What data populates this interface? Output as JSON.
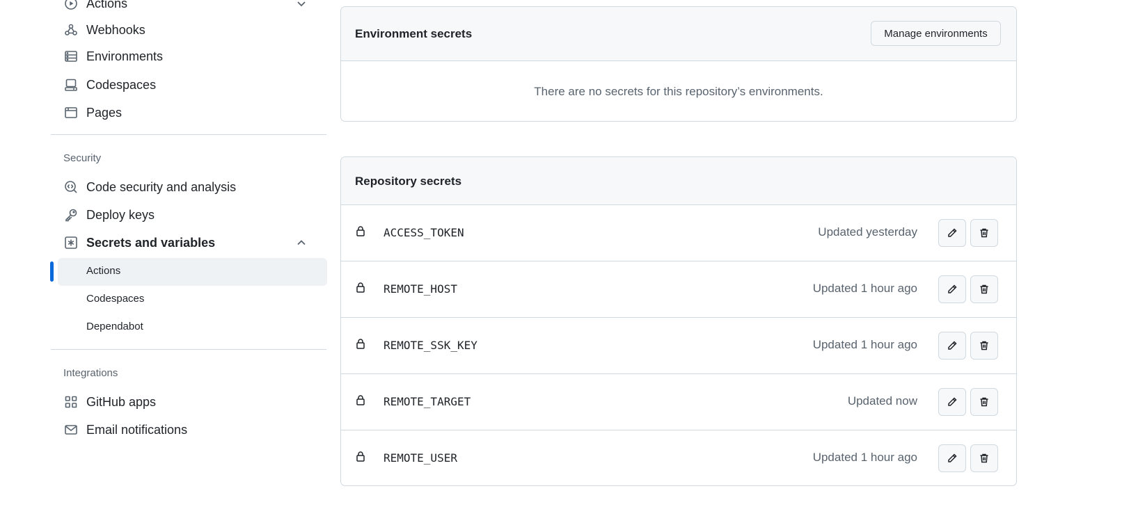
{
  "sidebar": {
    "top_items": [
      {
        "label": "Actions",
        "icon": "play-icon"
      },
      {
        "label": "Webhooks",
        "icon": "webhook-icon"
      },
      {
        "label": "Environments",
        "icon": "server-icon"
      },
      {
        "label": "Codespaces",
        "icon": "codespaces-icon"
      },
      {
        "label": "Pages",
        "icon": "browser-icon"
      }
    ],
    "security_heading": "Security",
    "security_items": [
      {
        "label": "Code security and analysis",
        "icon": "codescan-icon"
      },
      {
        "label": "Deploy keys",
        "icon": "key-icon"
      },
      {
        "label": "Secrets and variables",
        "icon": "key-asterisk-icon"
      }
    ],
    "secrets_subitems": [
      {
        "label": "Actions",
        "active": true
      },
      {
        "label": "Codespaces",
        "active": false
      },
      {
        "label": "Dependabot",
        "active": false
      }
    ],
    "integrations_heading": "Integrations",
    "integration_items": [
      {
        "label": "GitHub apps",
        "icon": "apps-icon"
      },
      {
        "label": "Email notifications",
        "icon": "mail-icon"
      }
    ]
  },
  "environment_secrets": {
    "title": "Environment secrets",
    "manage_button": "Manage environments",
    "empty_message": "There are no secrets for this repository’s environments."
  },
  "repository_secrets": {
    "title": "Repository secrets",
    "items": [
      {
        "name": "ACCESS_TOKEN",
        "updated": "Updated yesterday"
      },
      {
        "name": "REMOTE_HOST",
        "updated": "Updated 1 hour ago"
      },
      {
        "name": "REMOTE_SSK_KEY",
        "updated": "Updated 1 hour ago"
      },
      {
        "name": "REMOTE_TARGET",
        "updated": "Updated now"
      },
      {
        "name": "REMOTE_USER",
        "updated": "Updated 1 hour ago"
      }
    ]
  },
  "colors": {
    "accent": "#0969da",
    "border": "#d1d9e0",
    "muted_text": "#59636e",
    "header_bg": "#f6f8fa"
  }
}
